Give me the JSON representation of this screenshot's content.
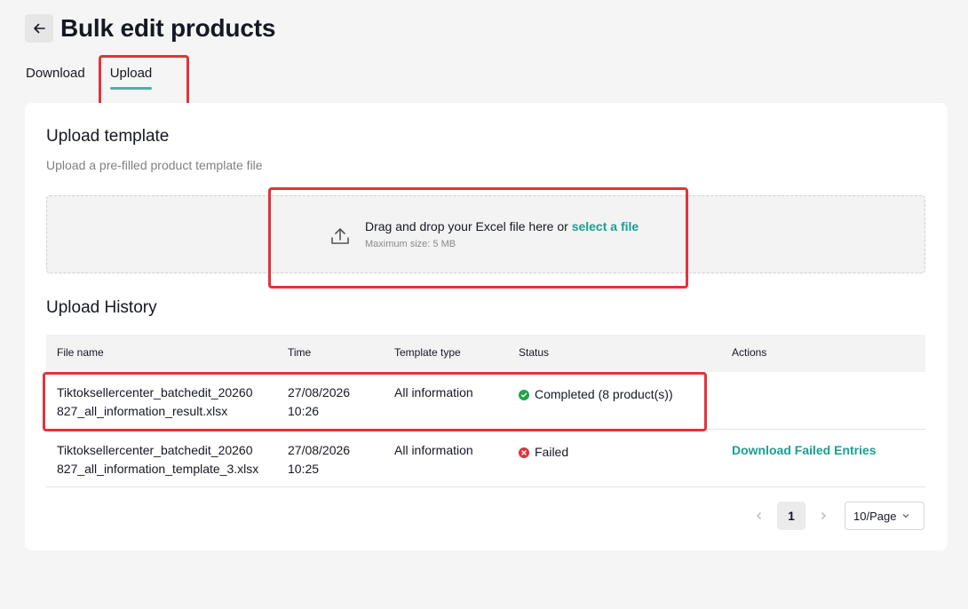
{
  "header": {
    "title": "Bulk edit products",
    "back_icon": "arrow-left-icon"
  },
  "tabs": [
    {
      "label": "Download",
      "active": false
    },
    {
      "label": "Upload",
      "active": true
    }
  ],
  "upload_template": {
    "title": "Upload template",
    "subtitle": "Upload a pre-filled product template file",
    "dropzone": {
      "icon": "upload-icon",
      "text": "Drag and drop your Excel file here or ",
      "link": "select a file",
      "max_size": "Maximum size: 5 MB"
    }
  },
  "history": {
    "title": "Upload History",
    "columns": [
      "File name",
      "Time",
      "Template type",
      "Status",
      "Actions"
    ],
    "rows": [
      {
        "file_name_line1": "Tiktoksellercenter_batchedit_20260",
        "file_name_line2": "827_all_information_result.xlsx",
        "date": "27/08/2026",
        "time": "10:26",
        "template": "All information",
        "status": "Completed (8 product(s))",
        "status_type": "success",
        "action": ""
      },
      {
        "file_name_line1": "Tiktoksellercenter_batchedit_20260",
        "file_name_line2": "827_all_information_template_3.xlsx",
        "date": "27/08/2026",
        "time": "10:25",
        "template": "All information",
        "status": "Failed",
        "status_type": "error",
        "action": "Download Failed Entries"
      }
    ]
  },
  "pagination": {
    "current_page": "1",
    "page_size": "10/Page"
  },
  "colors": {
    "accent": "#1a9f92",
    "success": "#24a148",
    "error": "#e0323c",
    "highlight": "#e3323c"
  }
}
